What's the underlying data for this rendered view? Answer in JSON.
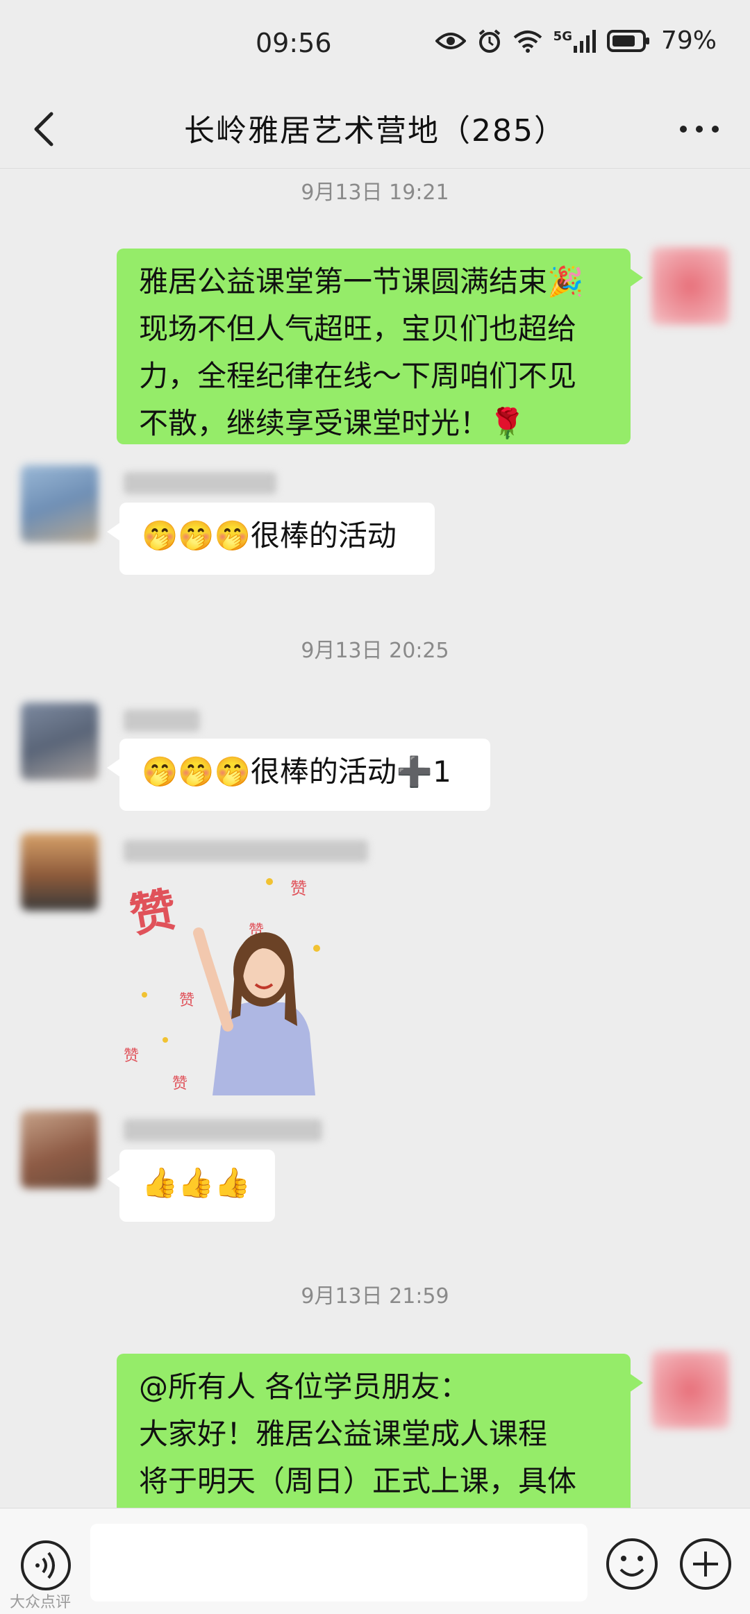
{
  "status_bar": {
    "time": "09:56",
    "network": "5G",
    "battery": "79%"
  },
  "header": {
    "title": "长岭雅居艺术营地（285）"
  },
  "messages": [
    {
      "type": "timestamp",
      "text": "9月13日 19:21"
    },
    {
      "type": "outgoing",
      "lines": [
        "雅居公益课堂第一节课圆满结束🎉",
        "现场不但人气超旺，宝贝们也超给",
        "力，全程纪律在线～下周咱们不见",
        "不散，继续享受课堂时光！🌹"
      ]
    },
    {
      "type": "incoming",
      "text": "🤭🤭🤭很棒的活动"
    },
    {
      "type": "timestamp",
      "text": "9月13日 20:25"
    },
    {
      "type": "incoming",
      "text": "🤭🤭🤭很棒的活动➕1"
    },
    {
      "type": "incoming-sticker",
      "text": "赞"
    },
    {
      "type": "incoming",
      "text": "👍👍👍"
    },
    {
      "type": "timestamp",
      "text": "9月13日 21:59"
    },
    {
      "type": "outgoing",
      "lines": [
        "@所有人 各位学员朋友：",
        "大家好！雅居公益课堂成人课程",
        "将于明天（周日）正式上课，具体"
      ]
    }
  ],
  "watermark": "大众点评",
  "icons": {
    "back": "chevron-left-icon",
    "more": "more-dots-icon",
    "voice": "voice-icon",
    "emoji": "emoji-icon",
    "plus": "plus-icon"
  },
  "colors": {
    "outgoing_bubble": "#95ec69",
    "incoming_bubble": "#ffffff",
    "background": "#ededed"
  }
}
